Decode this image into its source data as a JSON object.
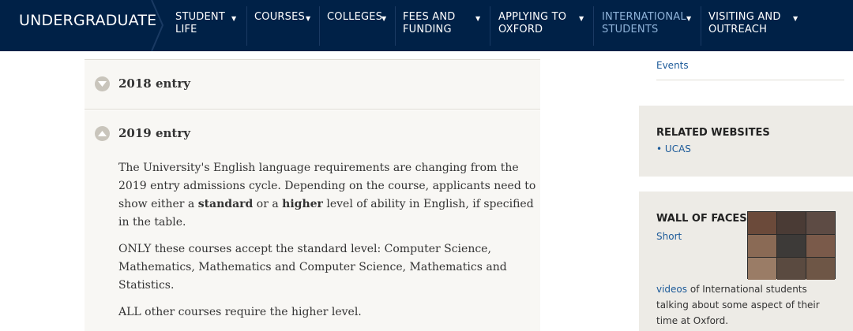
{
  "nav": {
    "brand": "UNDERGRADUATE",
    "items": [
      {
        "label": "STUDENT\nLIFE",
        "active": false
      },
      {
        "label": "COURSES",
        "active": false
      },
      {
        "label": "COLLEGES",
        "active": false
      },
      {
        "label": "FEES AND\nFUNDING",
        "active": false
      },
      {
        "label": "APPLYING TO\nOXFORD",
        "active": false
      },
      {
        "label": "INTERNATIONAL\nSTUDENTS",
        "active": true
      },
      {
        "label": "VISITING AND\nOUTREACH",
        "active": false
      }
    ],
    "caret_icon": "chevron-down-icon",
    "colors": {
      "background": "#002147",
      "active_text": "#8fb3d9"
    }
  },
  "accordion": {
    "sections": [
      {
        "title": "2018 entry",
        "expanded": false,
        "icon": "expand-down-icon"
      },
      {
        "title": "2019 entry",
        "expanded": true,
        "icon": "collapse-up-icon",
        "body": {
          "p1_a": "The University's English language requirements are changing from the 2019 entry admissions cycle. Depending on the course, applicants need to show either a ",
          "p1_b": "standard",
          "p1_c": " or a ",
          "p1_d": "higher",
          "p1_e": " level of ability in English, if specified in the table.",
          "p2": "ONLY these courses accept the standard level: Computer Science, Mathematics, Mathematics and Computer Science, Mathematics and Statistics.",
          "p3": "ALL other courses require the higher level."
        }
      }
    ]
  },
  "sidebar": {
    "events_link": "Events",
    "related": {
      "title": "RELATED WEBSITES",
      "bullet": "•",
      "links": [
        "UCAS"
      ]
    },
    "wall": {
      "title": "WALL OF FACES",
      "short_link": "Short",
      "videos_link": "videos",
      "text_after": " of International students talking about some aspect of their time at Oxford."
    }
  },
  "colors": {
    "link": "#1c5a99",
    "panel": "#f8f7f4",
    "sidebar_box": "#edebe6"
  }
}
